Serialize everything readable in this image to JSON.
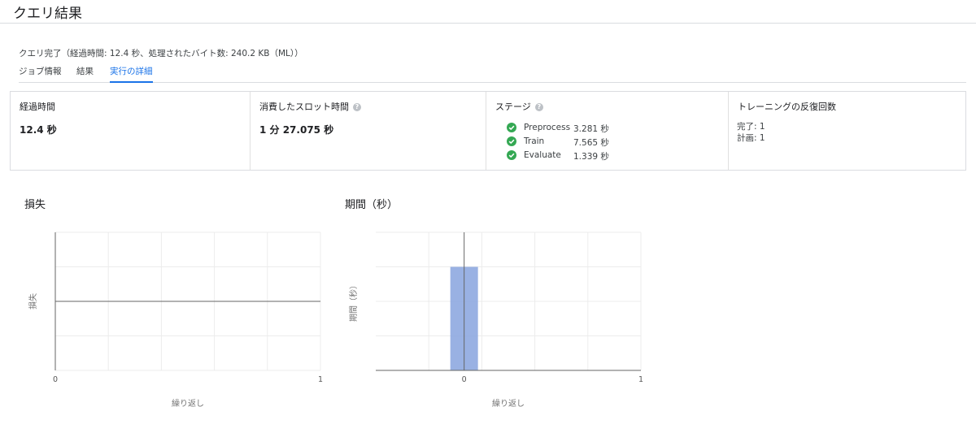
{
  "header": {
    "title": "クエリ結果"
  },
  "status": "クエリ完了（経過時間: 12.4 秒、処理されたバイト数: 240.2 KB（ML））",
  "tabs": [
    {
      "label": "ジョブ情報",
      "active": false
    },
    {
      "label": "結果",
      "active": false
    },
    {
      "label": "実行の詳細",
      "active": true
    }
  ],
  "stats": {
    "elapsed": {
      "title": "経過時間",
      "value": "12.4 秒"
    },
    "slot": {
      "title": "消費したスロット時間",
      "value": "1 分 27.075 秒",
      "help_icon": "help-icon"
    },
    "stages": {
      "title": "ステージ",
      "help_icon": "help-icon",
      "items": [
        {
          "name": "Preprocess",
          "time": "3.281 秒",
          "icon": "check-circle-icon"
        },
        {
          "name": "Train",
          "time": "7.565 秒",
          "icon": "check-circle-icon"
        },
        {
          "name": "Evaluate",
          "time": "1.339 秒",
          "icon": "check-circle-icon"
        }
      ]
    },
    "iterations": {
      "title": "トレーニングの反復回数",
      "completed": "完了: 1",
      "planned": "計画: 1"
    }
  },
  "colors": {
    "accent": "#1a73e8",
    "success": "#34a853",
    "bar": "#8ea8e0"
  },
  "chart_data": [
    {
      "type": "line",
      "title": "損失",
      "xlabel": "繰り返し",
      "ylabel": "損失",
      "x_ticks": [
        "0",
        "1"
      ],
      "xlim": [
        0,
        1
      ],
      "series": [
        {
          "values": []
        }
      ],
      "grid": true
    },
    {
      "type": "bar",
      "title": "期間（秒）",
      "xlabel": "繰り返し",
      "ylabel": "期間（秒）",
      "x_ticks": [
        "0",
        "1"
      ],
      "xlim": [
        -0.5,
        1
      ],
      "ylim": [
        0,
        4
      ],
      "categories": [
        0
      ],
      "values": [
        3
      ],
      "grid": true
    }
  ]
}
